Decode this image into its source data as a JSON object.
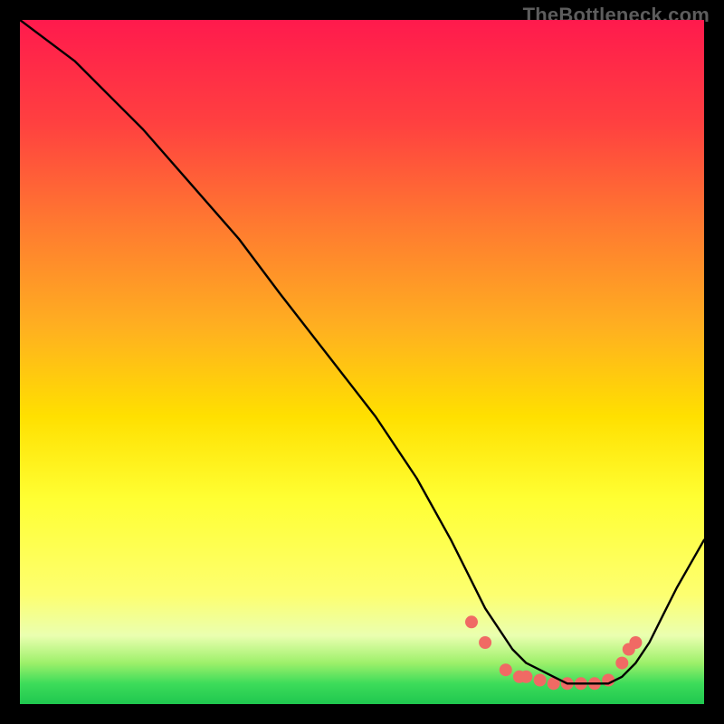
{
  "chart_data": {
    "type": "line",
    "watermark": "TheBottleneck.com",
    "title": "",
    "xlabel": "",
    "ylabel": "",
    "xlim": [
      0,
      100
    ],
    "ylim": [
      0,
      100
    ],
    "grid": false,
    "legend": false,
    "series": [
      {
        "name": "curve",
        "x": [
          0,
          8,
          12,
          18,
          25,
          32,
          38,
          45,
          52,
          58,
          63,
          66,
          68,
          70,
          72,
          74,
          76,
          78,
          80,
          82,
          84,
          86,
          88,
          90,
          92,
          94,
          96,
          100
        ],
        "values": [
          100,
          94,
          90,
          84,
          76,
          68,
          60,
          51,
          42,
          33,
          24,
          18,
          14,
          11,
          8,
          6,
          5,
          4,
          3,
          3,
          3,
          3,
          4,
          6,
          9,
          13,
          17,
          24
        ]
      }
    ],
    "dot_color": "#f06a64",
    "dot_radius_css": 7,
    "dots": [
      {
        "x": 66,
        "y": 12
      },
      {
        "x": 68,
        "y": 9
      },
      {
        "x": 71,
        "y": 5
      },
      {
        "x": 73,
        "y": 4
      },
      {
        "x": 74,
        "y": 4
      },
      {
        "x": 76,
        "y": 3.5
      },
      {
        "x": 78,
        "y": 3
      },
      {
        "x": 80,
        "y": 3
      },
      {
        "x": 82,
        "y": 3
      },
      {
        "x": 84,
        "y": 3
      },
      {
        "x": 86,
        "y": 3.5
      },
      {
        "x": 88,
        "y": 6
      },
      {
        "x": 89,
        "y": 8
      },
      {
        "x": 90,
        "y": 9
      }
    ]
  }
}
